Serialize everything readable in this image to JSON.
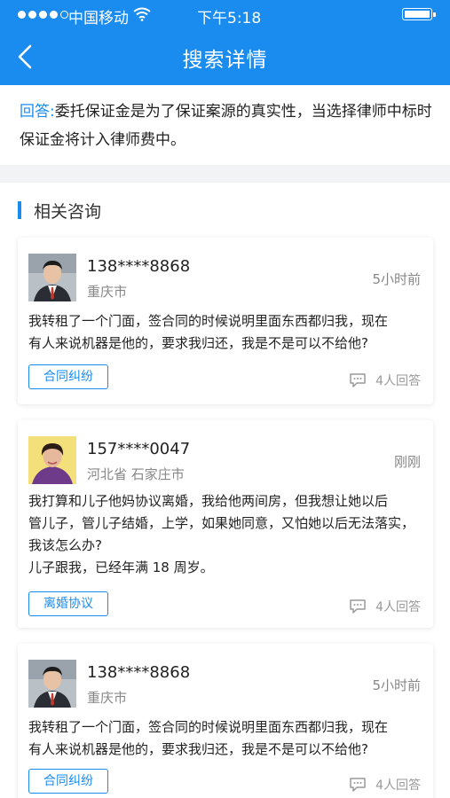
{
  "status_bar": {
    "carrier": "中国移动",
    "time": "下午5:18"
  },
  "nav": {
    "title": "搜索详情"
  },
  "answer": {
    "label": "回答:",
    "text": "委托保证金是为了保证案源的真实性，当选择律师中标时保证金将计入律师费中。"
  },
  "related": {
    "title": "相关咨询",
    "items": [
      {
        "phone": "138****8868",
        "location": "重庆市",
        "time": "5小时前",
        "lines": [
          "我转租了一个门面，签合同的时候说明里面东西都归我，现在",
          "有人来说机器是他的，要求我归还，我是不是可以不给他?"
        ],
        "tag": "合同纠纷",
        "replies": "4人回答"
      },
      {
        "phone": "157****0047",
        "location": "河北省 石家庄市",
        "time": "刚刚",
        "lines": [
          "我打算和儿子他妈协议离婚，我给他两间房，但我想让她以后",
          "管儿子，管儿子结婚，上学，如果她同意，又怕她以后无法落实，",
          "我该怎么办?",
          "儿子跟我，已经年满 18 周岁。"
        ],
        "tag": "离婚协议",
        "replies": "4人回答"
      },
      {
        "phone": "138****8868",
        "location": "重庆市",
        "time": "5小时前",
        "lines": [
          "我转租了一个门面，签合同的时候说明里面东西都归我，现在",
          "有人来说机器是他的，要求我归还，我是不是可以不给他?"
        ],
        "tag": "合同纠纷",
        "replies": "4人回答"
      }
    ]
  }
}
